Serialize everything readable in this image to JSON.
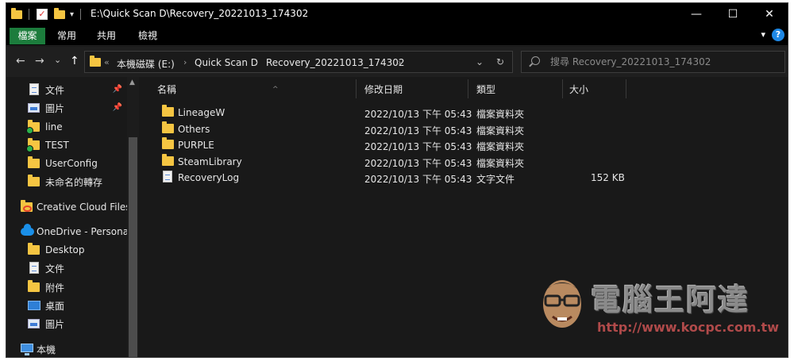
{
  "window": {
    "title": "E:\\Quick Scan D\\Recovery_20221013_174302",
    "minimize_glyph": "—",
    "maximize_glyph": "☐",
    "close_glyph": "✕"
  },
  "quick_access": {
    "customize_glyph": "▾"
  },
  "ribbon": {
    "tabs": [
      "檔案",
      "常用",
      "共用",
      "檢視"
    ],
    "expand_glyph": "▾",
    "help_glyph": "?"
  },
  "address": {
    "back_glyph": "←",
    "forward_glyph": "→",
    "recent_glyph": "⌄",
    "up_glyph": "↑",
    "overflow": "«",
    "crumbs": [
      "本機磁碟 (E:)",
      "Quick Scan D",
      "Recovery_20221013_174302"
    ],
    "separator": "›",
    "dropdown_glyph": "⌄",
    "refresh_glyph": "↻"
  },
  "search": {
    "placeholder": "搜尋 Recovery_20221013_174302"
  },
  "nav_pane": {
    "items": [
      {
        "label": "文件",
        "icon": "document-icon",
        "pinned": true
      },
      {
        "label": "圖片",
        "icon": "pictures-icon",
        "pinned": true
      },
      {
        "label": "line",
        "icon": "folder-sync-icon"
      },
      {
        "label": "TEST",
        "icon": "folder-sync-icon"
      },
      {
        "label": "UserConfig",
        "icon": "folder-icon"
      },
      {
        "label": "未命名的轉存",
        "icon": "folder-icon"
      },
      {
        "label": "Creative Cloud Files",
        "icon": "creative-cloud-folder-icon"
      },
      {
        "label": "OneDrive - Personal",
        "icon": "onedrive-cloud-icon"
      },
      {
        "label": "Desktop",
        "icon": "folder-icon"
      },
      {
        "label": "文件",
        "icon": "document-icon"
      },
      {
        "label": "附件",
        "icon": "folder-icon"
      },
      {
        "label": "桌面",
        "icon": "desktop-icon"
      },
      {
        "label": "圖片",
        "icon": "pictures-icon"
      },
      {
        "label": "本機",
        "icon": "this-pc-icon"
      }
    ],
    "pin_glyph": "📌",
    "scroll_up_glyph": "▲"
  },
  "list": {
    "sort_glyph": "^",
    "columns": {
      "name": "名稱",
      "modified": "修改日期",
      "type": "類型",
      "size": "大小"
    },
    "rows": [
      {
        "name": "LineageW",
        "modified": "2022/10/13 下午 05:43",
        "type": "檔案資料夾",
        "size": "",
        "icon": "folder-icon"
      },
      {
        "name": "Others",
        "modified": "2022/10/13 下午 05:43",
        "type": "檔案資料夾",
        "size": "",
        "icon": "folder-icon"
      },
      {
        "name": "PURPLE",
        "modified": "2022/10/13 下午 05:43",
        "type": "檔案資料夾",
        "size": "",
        "icon": "folder-icon"
      },
      {
        "name": "SteamLibrary",
        "modified": "2022/10/13 下午 05:43",
        "type": "檔案資料夾",
        "size": "",
        "icon": "folder-icon"
      },
      {
        "name": "RecoveryLog",
        "modified": "2022/10/13 下午 05:43",
        "type": "文字文件",
        "size": "152 KB",
        "icon": "text-file-icon"
      }
    ]
  },
  "watermark": {
    "title": "電腦王阿達",
    "url": "http://www.kocpc.com.tw"
  },
  "colors": {
    "background": "#191919",
    "title_bar": "#000000",
    "active_tab": "#1c7c3c",
    "folder": "#f5c542",
    "text": "#e6e6e6"
  }
}
